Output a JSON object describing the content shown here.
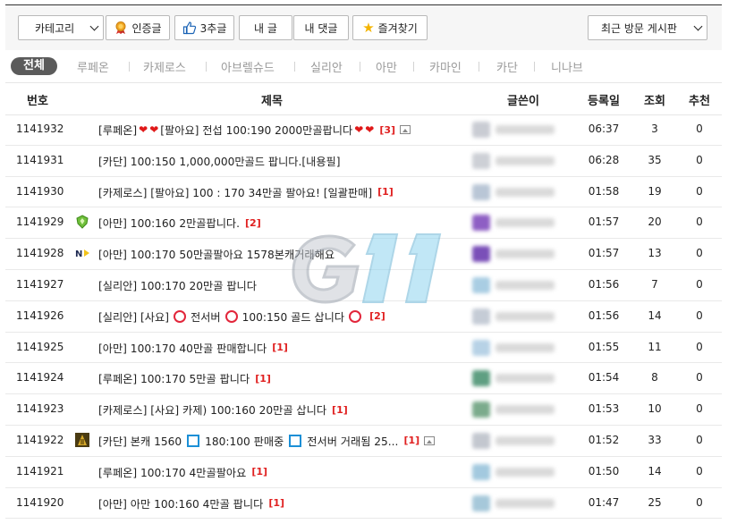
{
  "toolbar": {
    "category_select": "카테고리",
    "certified_label": "인증글",
    "recommend_label": "3추글",
    "my_posts_label": "내 글",
    "my_comments_label": "내 댓글",
    "favorites_label": "즐겨찾기",
    "recent_boards_select": "최근 방문 게시판"
  },
  "tabs": [
    "전체",
    "루페온",
    "카제로스",
    "아브렐슈드",
    "실리안",
    "아만",
    "카마인",
    "카단",
    "니나브"
  ],
  "table": {
    "headers": {
      "num": "번호",
      "title": "제목",
      "author": "글쓴이",
      "date": "등록일",
      "views": "조회",
      "recommend": "추천"
    },
    "rows": [
      {
        "num": "1141932",
        "parts": [
          "[루페온]",
          "heart",
          "heart",
          "[팔아요] 전섭 100:190 2000만골팝니다",
          "heart",
          "heart"
        ],
        "count": "[3]",
        "image": true,
        "date": "06:37",
        "views": "3",
        "rec": "0",
        "avatar": "#c9ccd3"
      },
      {
        "num": "1141931",
        "parts": [
          "[카단] 100:150 1,000,000만골드 팝니다.[내용필]"
        ],
        "count": "",
        "image": false,
        "date": "06:28",
        "views": "35",
        "rec": "0",
        "avatar": "#cdd0d6"
      },
      {
        "num": "1141930",
        "parts": [
          "[카제로스] [팔아요] 100 : 170 34만골 팔아요! [일괄판매]"
        ],
        "count": "[1]",
        "image": false,
        "date": "01:58",
        "views": "19",
        "rec": "0",
        "avatar": "#b9c6d6"
      },
      {
        "num": "1141929",
        "parts": [
          "[아만] 100:160 2만골팝니다."
        ],
        "count": "[2]",
        "image": false,
        "date": "01:57",
        "views": "20",
        "rec": "0",
        "avatar": "#8e5fc4",
        "level": "shield"
      },
      {
        "num": "1141928",
        "parts": [
          "[아만] 100:170 50만골팔아요 1578본캐거래해요"
        ],
        "count": "",
        "image": false,
        "date": "01:57",
        "views": "13",
        "rec": "0",
        "avatar": "#7a4fb8",
        "level": "n"
      },
      {
        "num": "1141927",
        "parts": [
          "[실리안] 100:170 20만골 팝니다"
        ],
        "count": "",
        "image": false,
        "date": "01:56",
        "views": "7",
        "rec": "0",
        "avatar": "#a9cde3"
      },
      {
        "num": "1141926",
        "parts": [
          "[실리안] [사요]",
          "ring",
          "전서버",
          "ring",
          "100:150 골드 삽니다",
          "ring"
        ],
        "count": "[2]",
        "image": false,
        "date": "01:56",
        "views": "14",
        "rec": "0",
        "avatar": "#c5ccd6"
      },
      {
        "num": "1141925",
        "parts": [
          "[아만] 100:170 40만골 판매합니다"
        ],
        "count": "[1]",
        "image": false,
        "date": "01:55",
        "views": "11",
        "rec": "0",
        "avatar": "#b7d2e6"
      },
      {
        "num": "1141924",
        "parts": [
          "[루페온] 100:170 5만골 팝니다"
        ],
        "count": "[1]",
        "image": false,
        "date": "01:54",
        "views": "8",
        "rec": "0",
        "avatar": "#5f9f82"
      },
      {
        "num": "1141923",
        "parts": [
          "[카제로스] [사요] 카제) 100:160 20만골 삽니다"
        ],
        "count": "[1]",
        "image": false,
        "date": "01:53",
        "views": "10",
        "rec": "0",
        "avatar": "#7bab8c"
      },
      {
        "num": "1141922",
        "parts": [
          "[카단] 본캐 1560",
          "sq",
          "180:100 판매중",
          "sq",
          "전서버 거래됨 25..."
        ],
        "count": "[1]",
        "image": true,
        "date": "01:52",
        "views": "33",
        "rec": "0",
        "avatar": "#c3c7cf",
        "level": "gold"
      },
      {
        "num": "1141921",
        "parts": [
          "[루페온] 100:170 4만골팔아요"
        ],
        "count": "[1]",
        "image": false,
        "date": "01:50",
        "views": "14",
        "rec": "0",
        "avatar": "#a3c9df"
      },
      {
        "num": "1141920",
        "parts": [
          "[아만] 아만 100:160 4만골 팝니다"
        ],
        "count": "[1]",
        "image": false,
        "date": "01:47",
        "views": "25",
        "rec": "0",
        "avatar": "#a6c8da"
      }
    ]
  },
  "watermark": "G11",
  "colors": {
    "accent_red": "#e02020",
    "active_tab": "#5b5b5b",
    "toolbar_bg": "#f6f6f6"
  }
}
